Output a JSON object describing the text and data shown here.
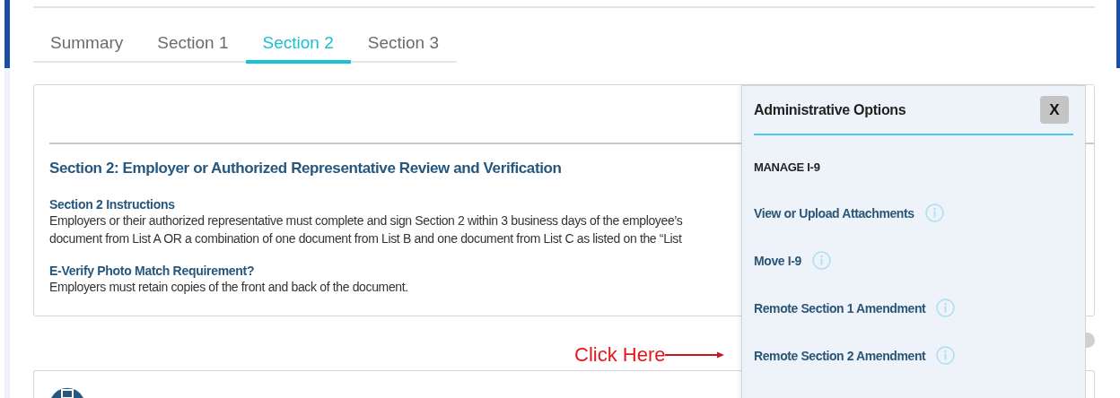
{
  "tabs": [
    {
      "label": "Summary",
      "selected": false
    },
    {
      "label": "Section 1",
      "selected": false
    },
    {
      "label": "Section 2",
      "selected": true
    },
    {
      "label": "Section 3",
      "selected": false
    }
  ],
  "section": {
    "title": "Section 2: Employer or Authorized Representative Review and Verification",
    "blocks": [
      {
        "heading": "Section 2 Instructions",
        "lines": [
          "Employers or their authorized representative must complete and sign Section 2 within 3 business days of the employee’s",
          "document from List A OR a combination of one document from List B and one document from List C as listed on the “List"
        ]
      },
      {
        "heading": "E-Verify Photo Match Requirement?",
        "lines": [
          "Employers must retain copies of the front and back of the document."
        ]
      }
    ]
  },
  "admin_panel": {
    "title": "Administrative Options",
    "close_label": "X",
    "group_label": "MANAGE I-9",
    "items": [
      {
        "label": "View or Upload Attachments"
      },
      {
        "label": "Move I-9"
      },
      {
        "label": "Remote Section 1 Amendment"
      },
      {
        "label": "Remote Section 2 Amendment"
      }
    ]
  },
  "annotation": {
    "text": "Click Here"
  }
}
